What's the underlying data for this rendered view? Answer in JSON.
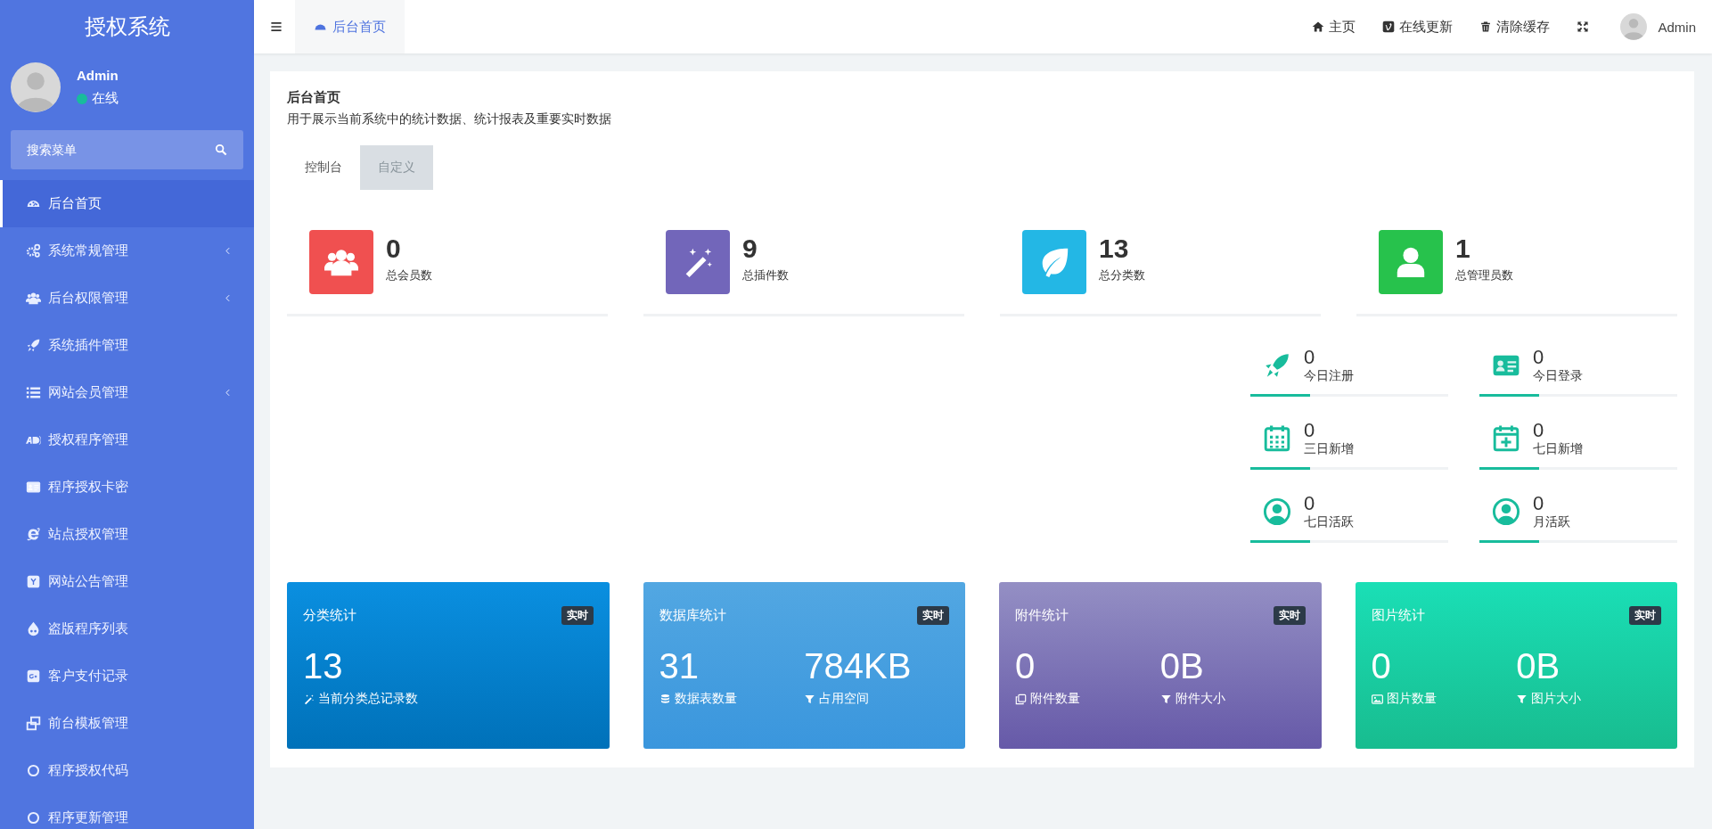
{
  "sidebar": {
    "logo": "授权系统",
    "user": {
      "name": "Admin",
      "status": "在线",
      "online": true
    },
    "search": {
      "placeholder": "搜索菜单"
    },
    "items": [
      {
        "kind": "dashboard",
        "label": "后台首页",
        "selected": true,
        "expandable": false
      },
      {
        "kind": "cogs",
        "label": "系统常规管理",
        "selected": false,
        "expandable": true
      },
      {
        "kind": "users",
        "label": "后台权限管理",
        "selected": false,
        "expandable": true
      },
      {
        "kind": "rocket",
        "label": "系统插件管理",
        "selected": false,
        "expandable": false
      },
      {
        "kind": "list",
        "label": "网站会员管理",
        "selected": false,
        "expandable": true
      },
      {
        "kind": "ad",
        "label": "授权程序管理",
        "selected": false,
        "expandable": false
      },
      {
        "kind": "card",
        "label": "程序授权卡密",
        "selected": false,
        "expandable": false
      },
      {
        "kind": "ie",
        "label": "站点授权管理",
        "selected": false,
        "expandable": false
      },
      {
        "kind": "ysquare",
        "label": "网站公告管理",
        "selected": false,
        "expandable": false
      },
      {
        "kind": "drop",
        "label": "盗版程序列表",
        "selected": false,
        "expandable": false
      },
      {
        "kind": "gplus",
        "label": "客户支付记录",
        "selected": false,
        "expandable": false
      },
      {
        "kind": "windows",
        "label": "前台模板管理",
        "selected": false,
        "expandable": false
      },
      {
        "kind": "circle",
        "label": "程序授权代码",
        "selected": false,
        "expandable": false
      },
      {
        "kind": "circle",
        "label": "程序更新管理",
        "selected": false,
        "expandable": false
      }
    ]
  },
  "topbar": {
    "tab": {
      "label": "后台首页"
    },
    "links": [
      {
        "kind": "home",
        "label": "主页"
      },
      {
        "kind": "vimeo",
        "label": "在线更新"
      },
      {
        "kind": "trash",
        "label": "清除缓存"
      },
      {
        "kind": "expand"
      }
    ],
    "user": "Admin"
  },
  "panel": {
    "title": "后台首页",
    "subtitle": "用于展示当前系统中的统计数据、统计报表及重要实时数据",
    "tabs": [
      {
        "label": "控制台",
        "selected": true
      },
      {
        "label": "自定义",
        "selected": false
      }
    ],
    "stats": [
      {
        "kind": "users",
        "value": "0",
        "label": "总会员数"
      },
      {
        "kind": "magic",
        "value": "9",
        "label": "总插件数"
      },
      {
        "kind": "leaf",
        "value": "13",
        "label": "总分类数"
      },
      {
        "kind": "user",
        "value": "1",
        "label": "总管理员数"
      }
    ],
    "mini_stats": [
      {
        "kind": "rocket",
        "value": "0",
        "label": "今日注册"
      },
      {
        "kind": "card",
        "value": "0",
        "label": "今日登录"
      },
      {
        "kind": "calendar",
        "value": "0",
        "label": "三日新增"
      },
      {
        "kind": "calplus",
        "value": "0",
        "label": "七日新增"
      },
      {
        "kind": "usercircle",
        "value": "0",
        "label": "七日活跃"
      },
      {
        "kind": "usercircle",
        "value": "0",
        "label": "月活跃"
      }
    ],
    "cards": [
      {
        "title": "分类统计",
        "badge": "实时",
        "metrics": [
          {
            "value": "13",
            "kind": "magic",
            "label": "当前分类总记录数"
          }
        ]
      },
      {
        "title": "数据库统计",
        "badge": "实时",
        "metrics": [
          {
            "value": "31",
            "kind": "database",
            "label": "数据表数量"
          },
          {
            "value": "784KB",
            "kind": "filter",
            "label": "占用空间"
          }
        ]
      },
      {
        "title": "附件统计",
        "badge": "实时",
        "metrics": [
          {
            "value": "0",
            "kind": "clone",
            "label": "附件数量"
          },
          {
            "value": "0B",
            "kind": "filter",
            "label": "附件大小"
          }
        ]
      },
      {
        "title": "图片统计",
        "badge": "实时",
        "metrics": [
          {
            "value": "0",
            "kind": "image",
            "label": "图片数量"
          },
          {
            "value": "0B",
            "kind": "filter",
            "label": "图片大小"
          }
        ]
      }
    ]
  }
}
